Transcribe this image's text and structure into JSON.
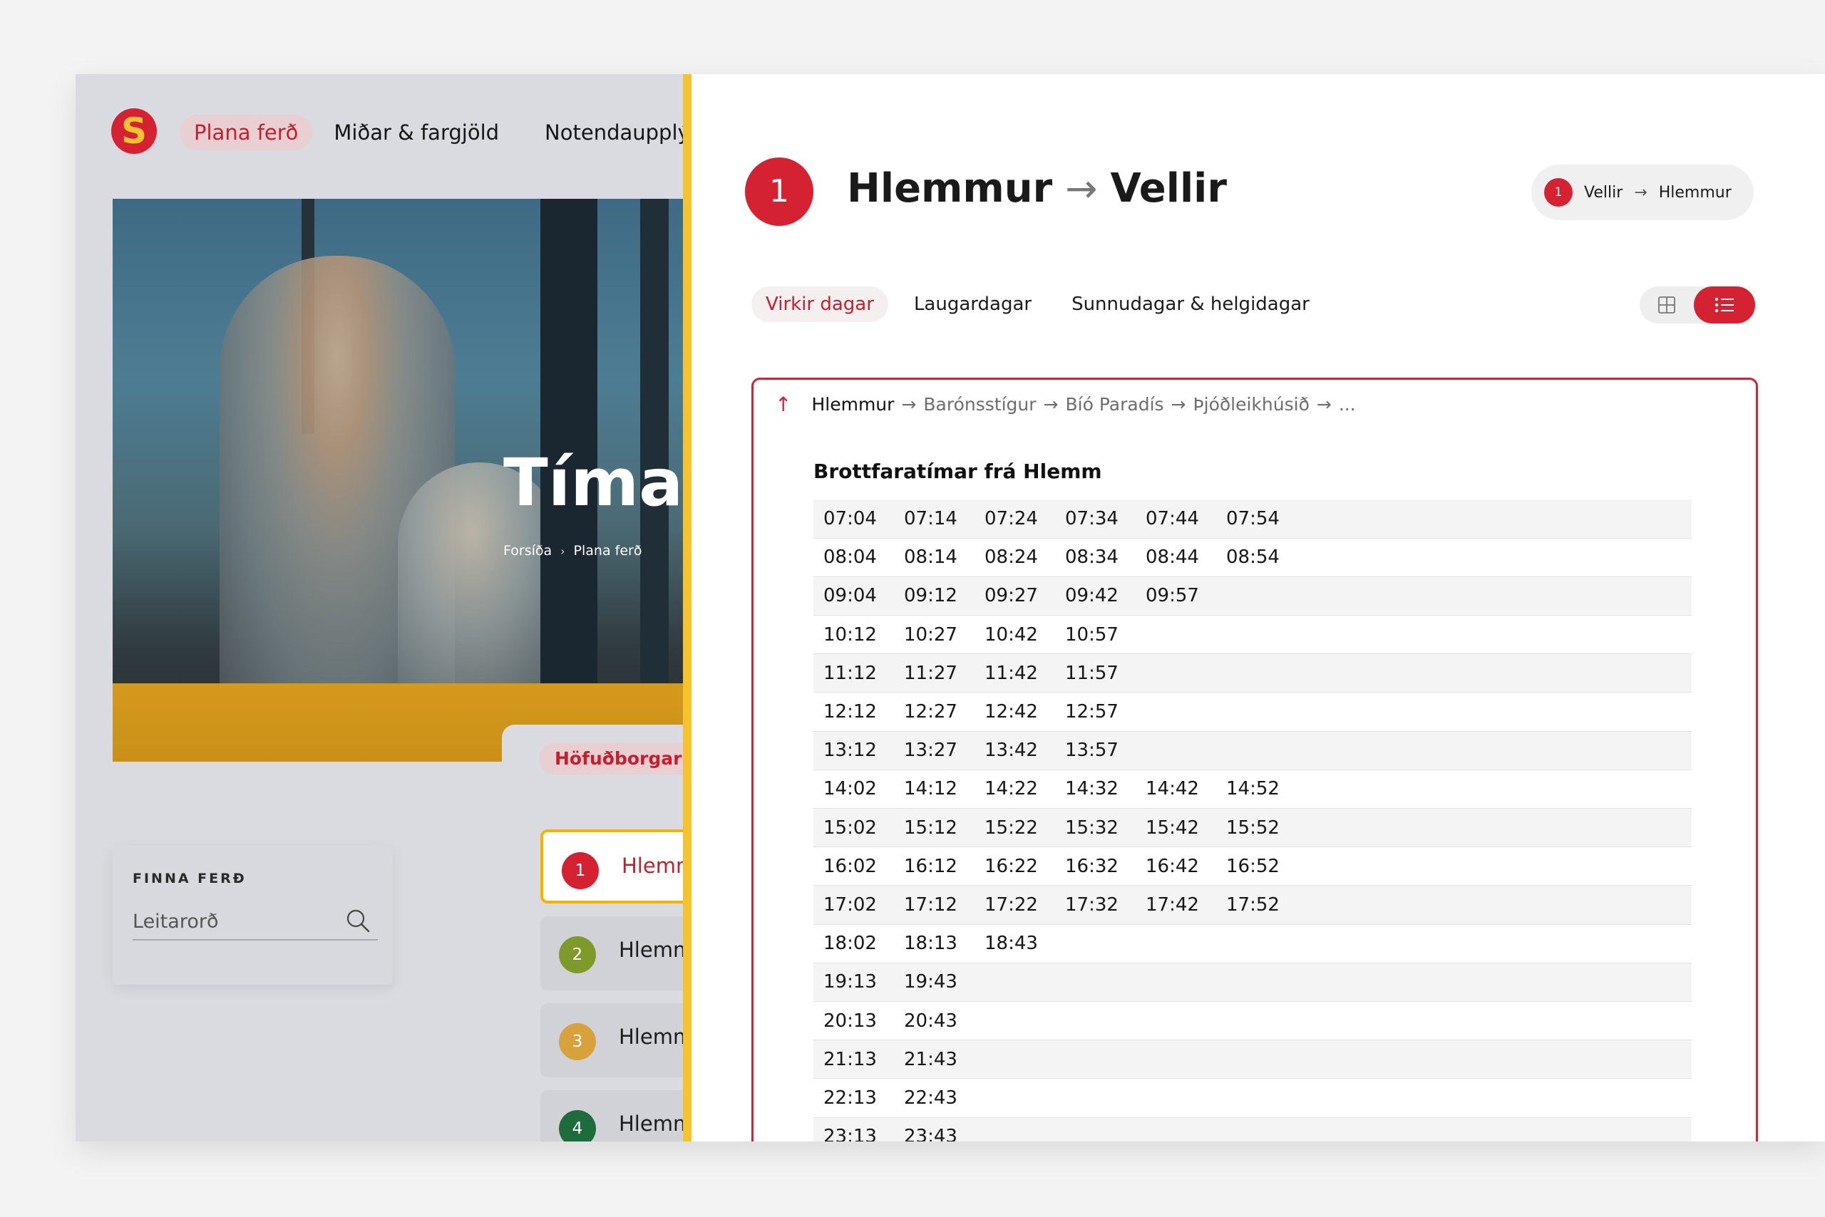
{
  "logo": {
    "letter": "S"
  },
  "nav": {
    "items": [
      "Plana ferð",
      "Miðar & fargjöld",
      "Notendaupplýsi"
    ]
  },
  "hero": {
    "title": "Tíma",
    "breadcrumb": [
      "Forsíða",
      "Plana ferð"
    ]
  },
  "region_chip": "Höfuðborgarsv",
  "search": {
    "label": "FINNA FERÐ",
    "placeholder": "Leitarorð"
  },
  "routes": [
    {
      "number": "1",
      "label": "Hlemm",
      "color": "#d42232"
    },
    {
      "number": "2",
      "label": "Hlemm",
      "color": "#7f9a2a"
    },
    {
      "number": "3",
      "label": "Hlemm",
      "color": "#d7a23b"
    },
    {
      "number": "4",
      "label": "Hlemm",
      "color": "#1e6b3b"
    }
  ],
  "panel": {
    "route_number": "1",
    "from": "Hlemmur",
    "to": "Vellir",
    "reverse": {
      "number": "1",
      "from": "Vellir",
      "to": "Hlemmur"
    },
    "day_tabs": [
      "Virkir dagar",
      "Laugardagar",
      "Sunnudagar & helgidagar"
    ],
    "stops": [
      "Hlemmur",
      "Barónsstígur",
      "Bíó Paradís",
      "Þjóðleikhúsið",
      "..."
    ],
    "schedule_heading": "Brottfaratímar frá Hlemm",
    "times": [
      [
        "07:04",
        "07:14",
        "07:24",
        "07:34",
        "07:44",
        "07:54"
      ],
      [
        "08:04",
        "08:14",
        "08:24",
        "08:34",
        "08:44",
        "08:54"
      ],
      [
        "09:04",
        "09:12",
        "09:27",
        "09:42",
        "09:57"
      ],
      [
        "10:12",
        "10:27",
        "10:42",
        "10:57"
      ],
      [
        "11:12",
        "11:27",
        "11:42",
        "11:57"
      ],
      [
        "12:12",
        "12:27",
        "12:42",
        "12:57"
      ],
      [
        "13:12",
        "13:27",
        "13:42",
        "13:57"
      ],
      [
        "14:02",
        "14:12",
        "14:22",
        "14:32",
        "14:42",
        "14:52"
      ],
      [
        "15:02",
        "15:12",
        "15:22",
        "15:32",
        "15:42",
        "15:52"
      ],
      [
        "16:02",
        "16:12",
        "16:22",
        "16:32",
        "16:42",
        "16:52"
      ],
      [
        "17:02",
        "17:12",
        "17:22",
        "17:32",
        "17:42",
        "17:52"
      ],
      [
        "18:02",
        "18:13",
        "18:43"
      ],
      [
        "19:13",
        "19:43"
      ],
      [
        "20:13",
        "20:43"
      ],
      [
        "21:13",
        "21:43"
      ],
      [
        "22:13",
        "22:43"
      ],
      [
        "23:13",
        "23:43"
      ]
    ]
  },
  "colors": {
    "brand_red": "#d42232",
    "brand_yellow": "#f5c230",
    "accent_text": "#c41f2f"
  }
}
